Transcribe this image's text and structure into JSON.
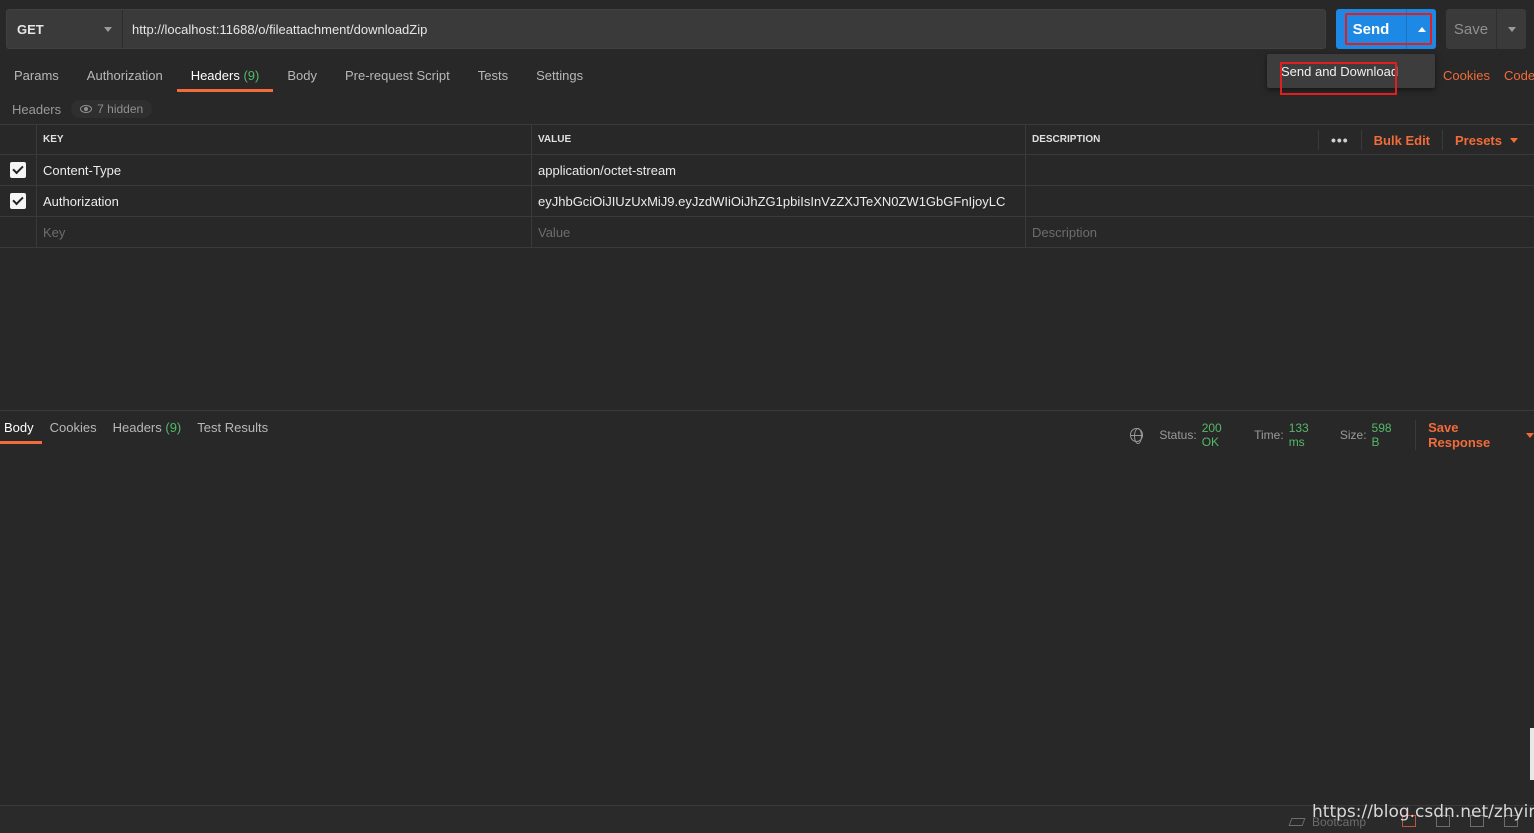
{
  "request": {
    "method": "GET",
    "url": "http://localhost:11688/o/fileattachment/downloadZip",
    "send_label": "Send",
    "save_label": "Save",
    "dropdown_item": "Send and Download"
  },
  "tabs": [
    {
      "label": "Params"
    },
    {
      "label": "Authorization"
    },
    {
      "label": "Headers",
      "count": "(9)",
      "active": true
    },
    {
      "label": "Body"
    },
    {
      "label": "Pre-request Script"
    },
    {
      "label": "Tests"
    },
    {
      "label": "Settings"
    }
  ],
  "right_links": {
    "cookies": "Cookies",
    "code": "Code"
  },
  "subheader": {
    "label": "Headers",
    "hidden": "7 hidden"
  },
  "table": {
    "columns": {
      "key": "KEY",
      "value": "VALUE",
      "description": "DESCRIPTION"
    },
    "bulk_edit": "Bulk Edit",
    "presets": "Presets",
    "more": "•••",
    "rows": [
      {
        "key": "Content-Type",
        "value": "application/octet-stream",
        "description": "",
        "checked": true
      },
      {
        "key": "Authorization",
        "value": "eyJhbGciOiJIUzUxMiJ9.eyJzdWIiOiJhZG1pbiIsInVzZXJTeXN0ZW1GbGFnIjoyLC",
        "description": "",
        "checked": true
      }
    ],
    "placeholders": {
      "key": "Key",
      "value": "Value",
      "description": "Description"
    }
  },
  "response": {
    "tabs": [
      {
        "label": "Body",
        "active": true
      },
      {
        "label": "Cookies"
      },
      {
        "label": "Headers",
        "count": "(9)"
      },
      {
        "label": "Test Results"
      }
    ],
    "status_label": "Status:",
    "status_value": "200 OK",
    "time_label": "Time:",
    "time_value": "133 ms",
    "size_label": "Size:",
    "size_value": "598 B",
    "save_response": "Save Response"
  },
  "footer": {
    "bootcamp": "Bootcamp",
    "watermark": "https://blog.csdn.net/zhyingvip"
  },
  "colors": {
    "accent": "#f26b3a",
    "send_blue": "#1e88e5",
    "success_green": "#55b86a",
    "highlight_red": "#e02020"
  }
}
